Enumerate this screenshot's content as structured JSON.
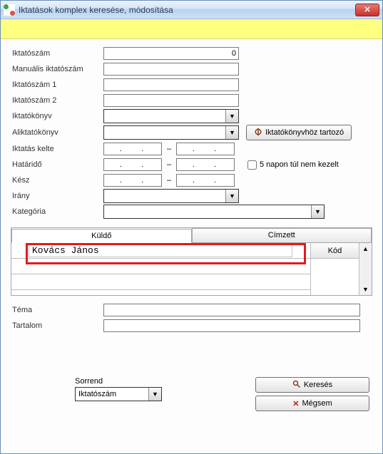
{
  "window": {
    "title": "Iktatások komplex keresése, módosítása"
  },
  "form": {
    "iktatoszam": {
      "label": "Iktatószám",
      "value": "0"
    },
    "manualis": {
      "label": "Manuális iktatószám",
      "value": ""
    },
    "iktatoszam1": {
      "label": "Iktatószám 1",
      "value": ""
    },
    "iktatoszam2": {
      "label": "Iktatószám 2",
      "value": ""
    },
    "iktatokonyv": {
      "label": "Iktatókönyv",
      "value": ""
    },
    "aliktatokonyv": {
      "label": "Aliktatókönyv",
      "value": ""
    },
    "iktatas_kelte": {
      "label": "Iktatás kelte"
    },
    "hatarido": {
      "label": "Határidő"
    },
    "kesz": {
      "label": "Kész"
    },
    "irany": {
      "label": "Irány",
      "value": ""
    },
    "kategoria": {
      "label": "Kategória",
      "value": ""
    },
    "tema": {
      "label": "Téma",
      "value": ""
    },
    "tartalom": {
      "label": "Tartalom",
      "value": ""
    },
    "date_placeholder": ".    .",
    "checkbox_label": "5 napon túl nem kezelt"
  },
  "buttons": {
    "iktatokonyvhoz": "Iktatókönyvhöz tartozó",
    "kereses": "Keresés",
    "megsem": "Mégsem"
  },
  "tabs": {
    "kuldo": "Küldő",
    "cimzett": "Címzett"
  },
  "grid": {
    "first_cell": "Kovács János",
    "kod_header": "Kód"
  },
  "order": {
    "label": "Sorrend",
    "value": "Iktatószám"
  }
}
